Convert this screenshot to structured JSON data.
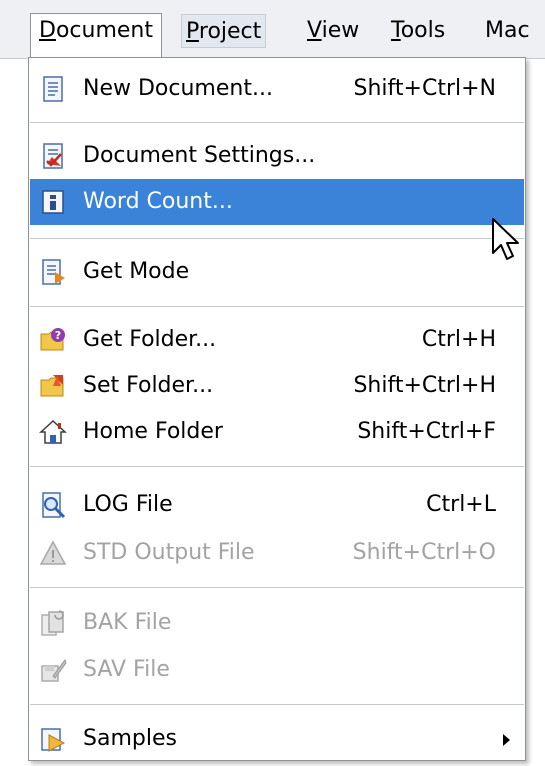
{
  "menubar": {
    "items": [
      {
        "label_pre": "",
        "label_acc": "D",
        "label_post": "ocument"
      },
      {
        "label_pre": "",
        "label_acc": "P",
        "label_post": "roject"
      },
      {
        "label_pre": "",
        "label_acc": "V",
        "label_post": "iew"
      },
      {
        "label_pre": "",
        "label_acc": "T",
        "label_post": "ools"
      },
      {
        "label_pre": "",
        "label_acc": "",
        "label_post": "Mac"
      }
    ]
  },
  "menu": {
    "items": [
      {
        "label": "New Document...",
        "shortcut": "Shift+Ctrl+N",
        "icon": "new-document-icon"
      },
      {
        "label": "Document Settings...",
        "shortcut": "",
        "icon": "document-settings-icon"
      },
      {
        "label": "Word Count...",
        "shortcut": "",
        "icon": "info-icon"
      },
      {
        "label": "Get Mode",
        "shortcut": "",
        "icon": "get-mode-icon"
      },
      {
        "label": "Get Folder...",
        "shortcut": "Ctrl+H",
        "icon": "folder-question-icon"
      },
      {
        "label": "Set Folder...",
        "shortcut": "Shift+Ctrl+H",
        "icon": "folder-set-icon"
      },
      {
        "label": "Home Folder",
        "shortcut": "Shift+Ctrl+F",
        "icon": "home-icon"
      },
      {
        "label": "LOG File",
        "shortcut": "Ctrl+L",
        "icon": "log-file-icon"
      },
      {
        "label": "STD Output File",
        "shortcut": "Shift+Ctrl+O",
        "icon": "warning-icon"
      },
      {
        "label": "BAK File",
        "shortcut": "",
        "icon": "bak-file-icon"
      },
      {
        "label": "SAV File",
        "shortcut": "",
        "icon": "sav-file-icon"
      },
      {
        "label": "Samples",
        "shortcut": "",
        "icon": "samples-icon"
      }
    ]
  },
  "colors": {
    "highlight": "#3b83d9",
    "disabled_text": "#a3a3a3",
    "menubar_bg": "#eef0f4"
  }
}
